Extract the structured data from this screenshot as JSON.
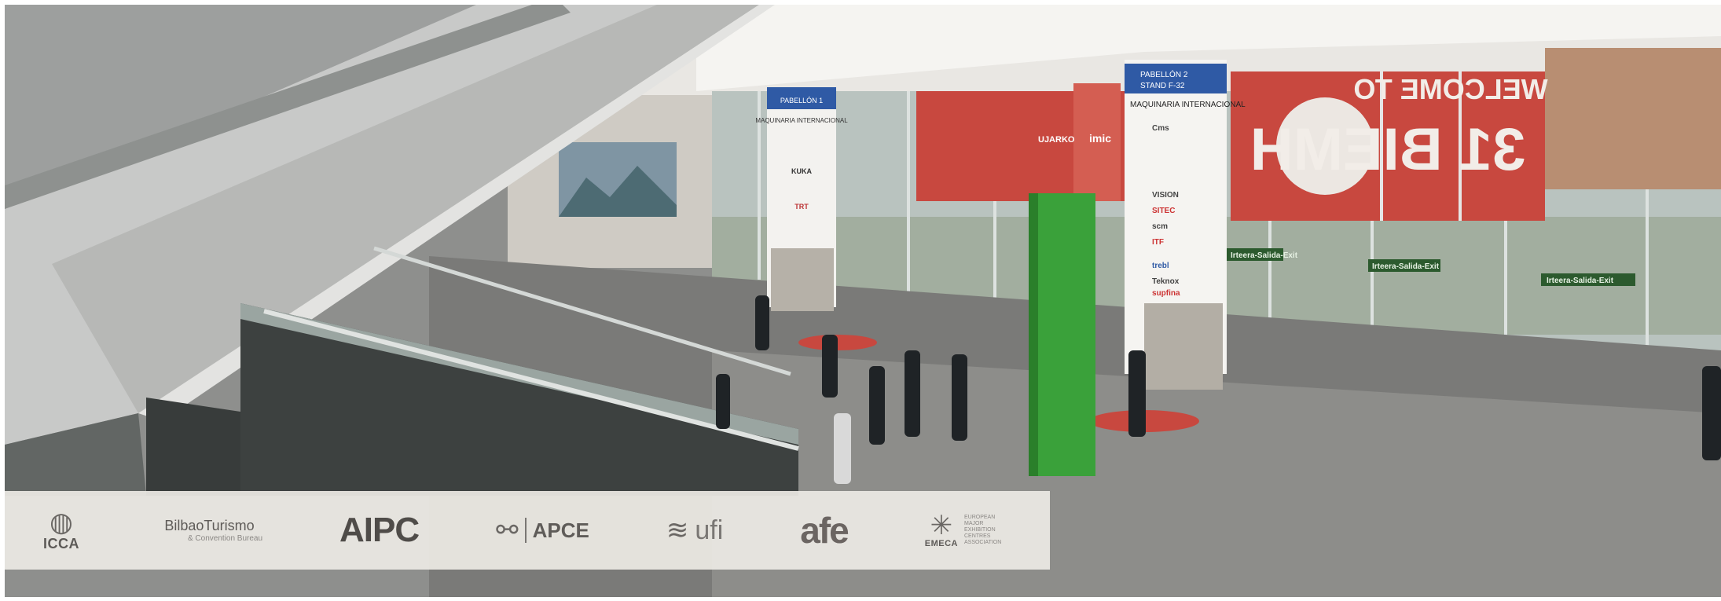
{
  "scene": {
    "description_colors": {
      "banner_red": "#c8483f",
      "floor": "#7a7a78",
      "green_column": "#3aa13a",
      "wall": "#cfcbc4"
    },
    "banner": {
      "mirrored_headline": "WELCOME TO",
      "mirrored_event": "31 BIEMH"
    },
    "pillar_left": {
      "top": "PABELLÓN 1",
      "heading": "MAQUINARIA INTERNACIONAL",
      "brands": [
        "KUKA",
        "TRT"
      ]
    },
    "pillar_right": {
      "top": "PABELLÓN 2",
      "stand": "STAND F-32",
      "heading": "MAQUINARIA INTERNACIONAL",
      "brands": [
        "Cms",
        "VISION",
        "SITEC",
        "scm",
        "ITF",
        "trebl",
        "Teknox",
        "supfina"
      ]
    },
    "exit_signs": [
      "Irteera-Salida-Exit",
      "Irteera-Salida-Exit",
      "Irteera-Salida-Exit"
    ],
    "small_signs": [
      "UJARKO",
      "imic"
    ]
  },
  "logos": {
    "icca": {
      "label": "ICCA",
      "icon": "globe-icon"
    },
    "bilbao": {
      "label": "BilbaoTurismo",
      "sub": "& Convention Bureau"
    },
    "aipc": {
      "label": "AIPC"
    },
    "apce": {
      "label": "APCE",
      "icon": "apce-mark-icon"
    },
    "ufi": {
      "label": "ufi",
      "icon": "ufi-wave-icon"
    },
    "afe": {
      "label": "afe"
    },
    "emeca": {
      "label": "EMECA",
      "icon": "star-mark-icon",
      "sub": "EUROPEAN MAJOR EXHIBITION CENTRES ASSOCIATION"
    }
  }
}
